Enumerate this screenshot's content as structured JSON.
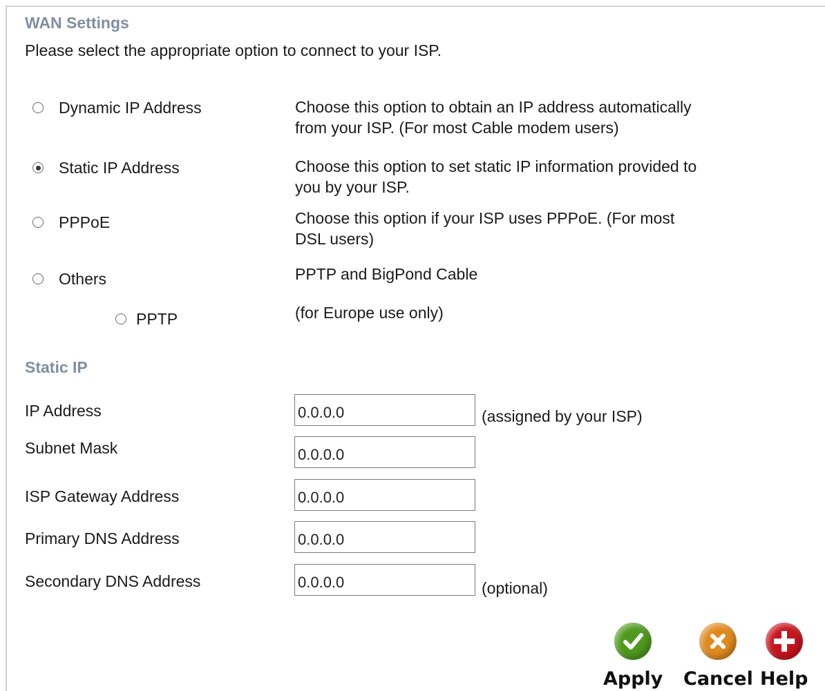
{
  "wan": {
    "title": "WAN Settings",
    "intro": "Please select the appropriate option to connect to your ISP.",
    "options": [
      {
        "label": "Dynamic IP Address",
        "desc1": "Choose this option to obtain an IP address automatically",
        "desc2": "from your ISP. (For most Cable modem users)",
        "checked": false
      },
      {
        "label": "Static IP Address",
        "desc1": "Choose this option to set static IP information provided to",
        "desc2": "you by your ISP.",
        "checked": true
      },
      {
        "label": "PPPoE",
        "desc1": "Choose this option if your ISP uses PPPoE. (For most",
        "desc2": "DSL users)",
        "checked": false
      },
      {
        "label": "Others",
        "desc1": "PPTP and BigPond Cable",
        "checked": false
      },
      {
        "label": "PPTP",
        "desc1": "(for Europe use only)",
        "checked": false
      }
    ]
  },
  "static": {
    "title": "Static IP",
    "fields": [
      {
        "label": "IP Address",
        "value": "0.0.0.0",
        "note": "(assigned by your ISP)"
      },
      {
        "label": "Subnet Mask",
        "value": "0.0.0.0"
      },
      {
        "label": "ISP Gateway Address",
        "value": "0.0.0.0"
      },
      {
        "label": "Primary DNS Address",
        "value": "0.0.0.0"
      },
      {
        "label": "Secondary DNS Address",
        "value": "0.0.0.0",
        "note": "(optional)"
      }
    ]
  },
  "buttons": {
    "apply": "Apply",
    "cancel": "Cancel",
    "help": "Help"
  },
  "colors": {
    "section_title": "#7f8fa3",
    "apply": "#4f9a1e",
    "cancel": "#e08a1e",
    "help": "#c8141e"
  }
}
